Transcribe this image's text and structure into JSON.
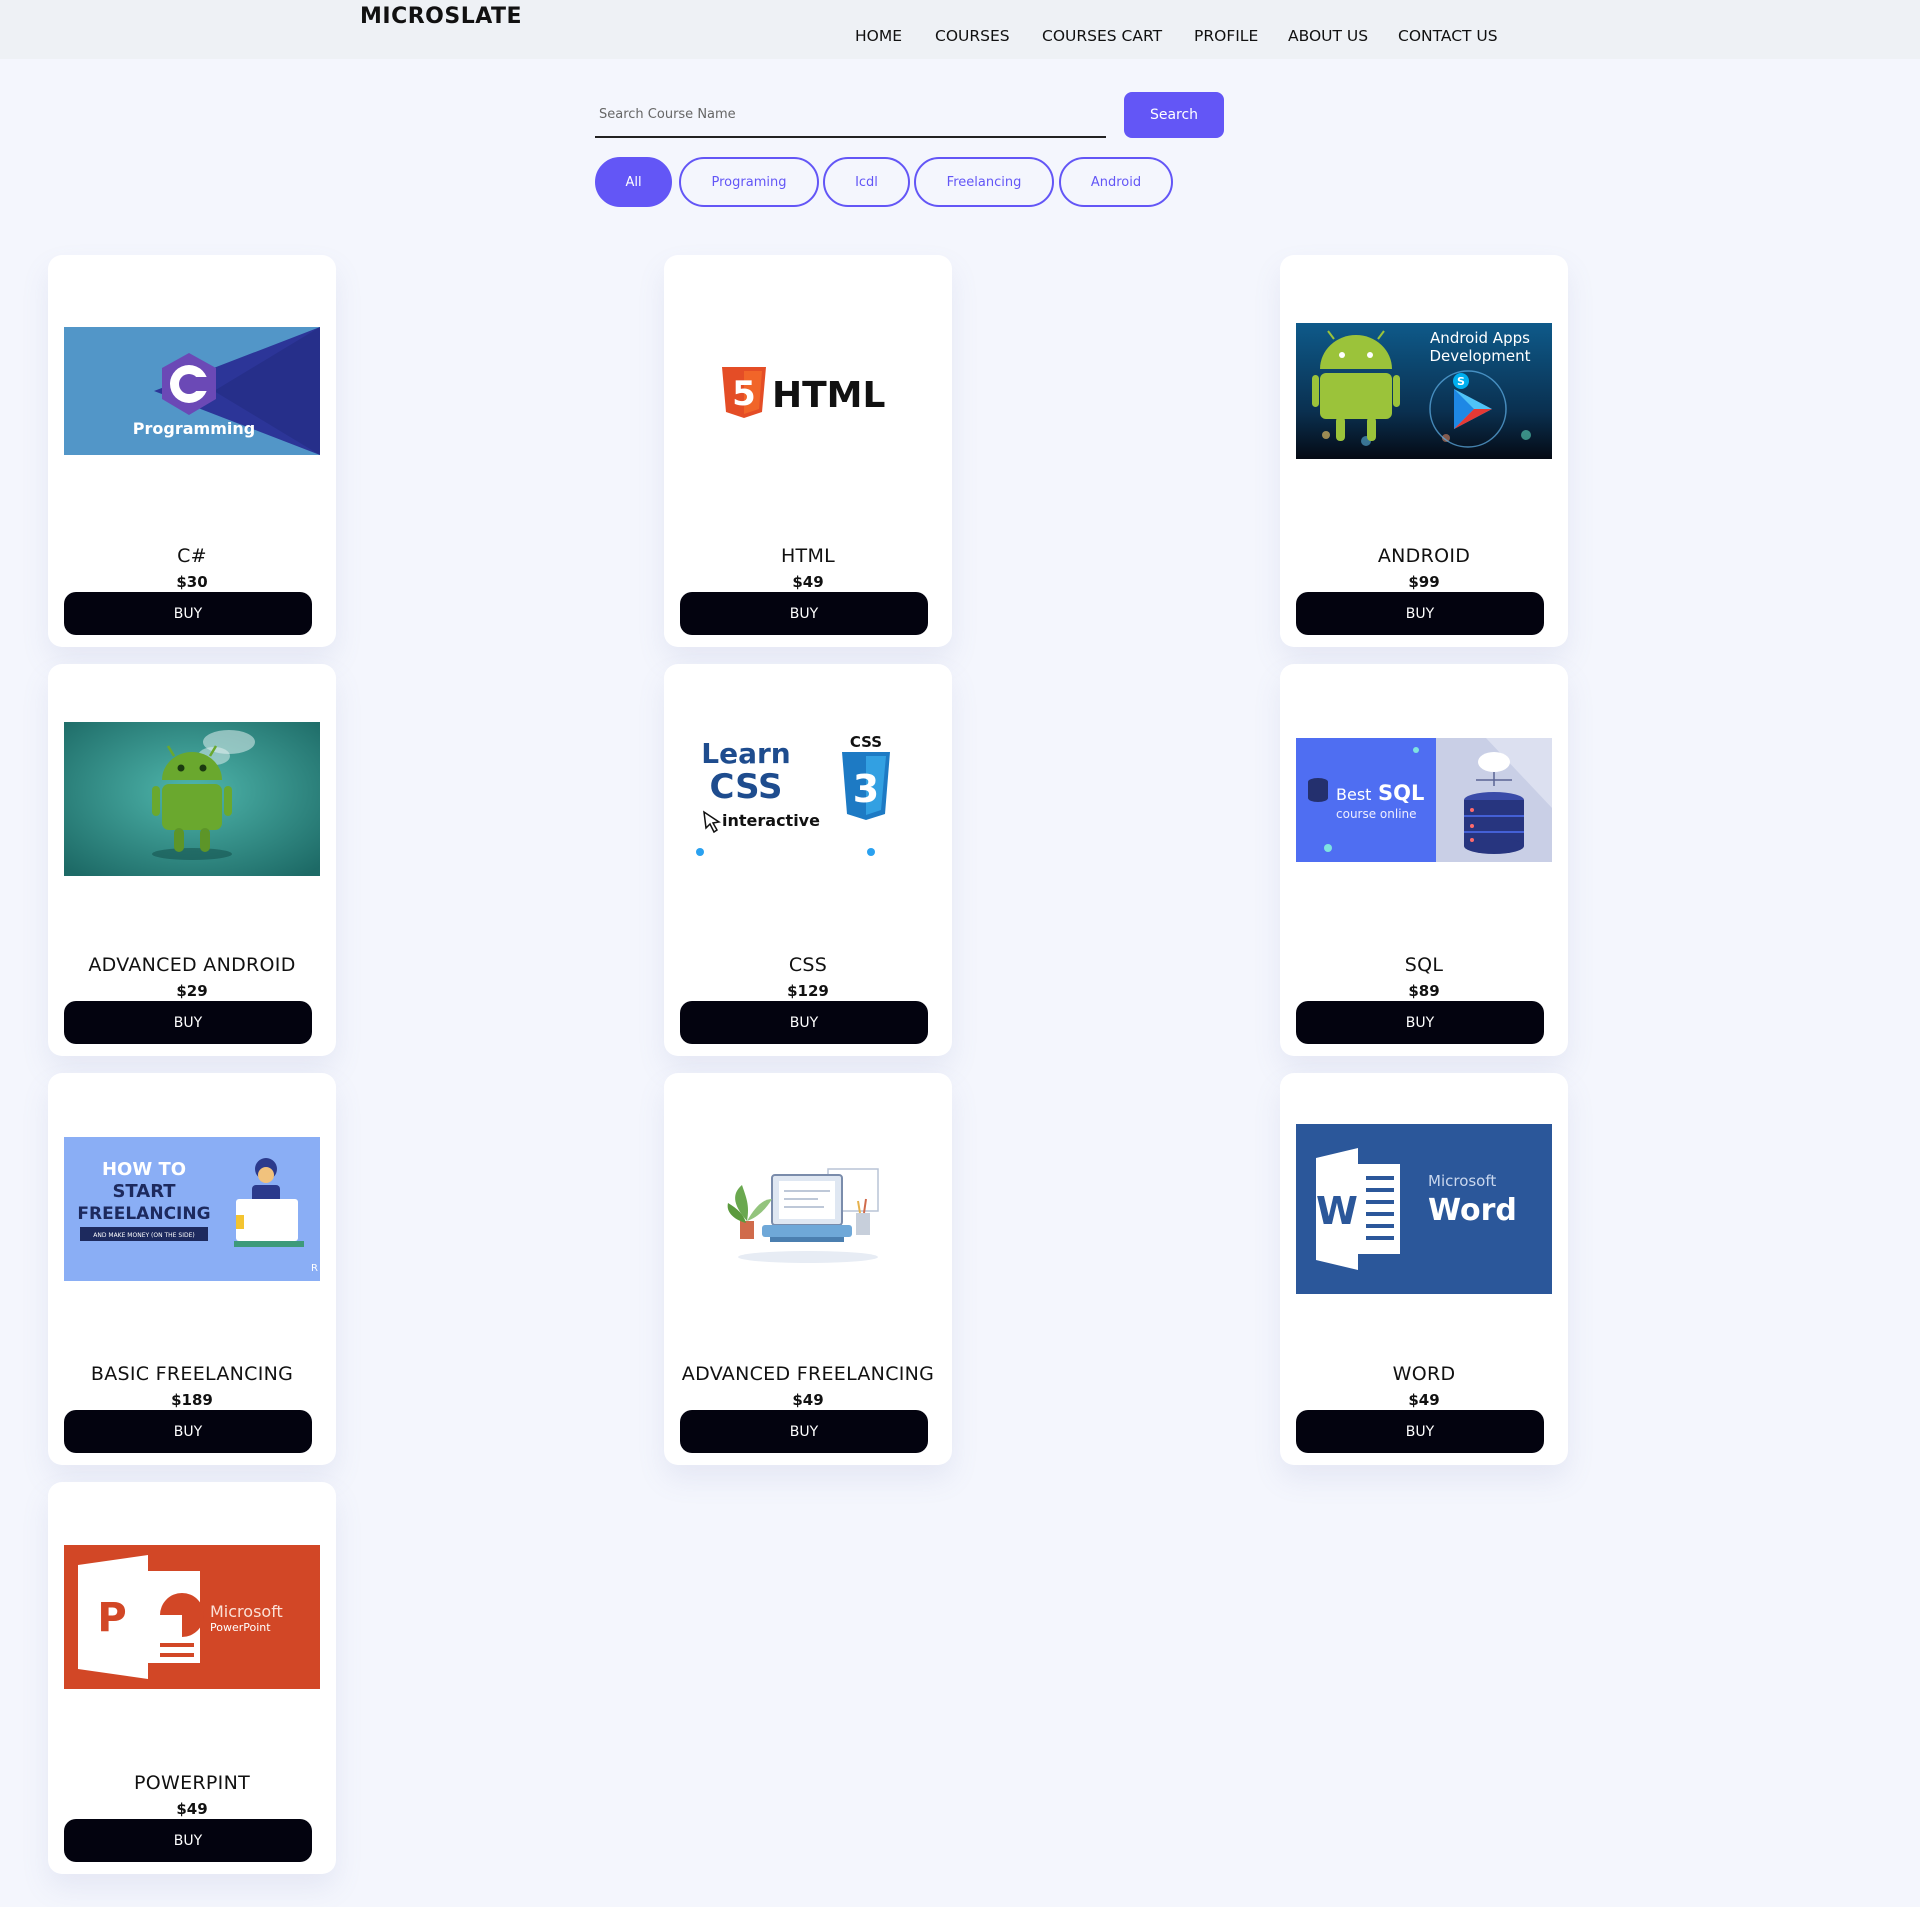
{
  "header": {
    "brand": "MICROSLATE",
    "nav": [
      "HOME",
      "COURSES",
      "COURSES CART",
      "PROFILE",
      "ABOUT US",
      "CONTACT US"
    ]
  },
  "search": {
    "placeholder": "Search Course Name",
    "value": "",
    "button_label": "Search"
  },
  "filters": [
    {
      "label": "All",
      "active": true
    },
    {
      "label": "Programing",
      "active": false
    },
    {
      "label": "Icdl",
      "active": false
    },
    {
      "label": "Freelancing",
      "active": false
    },
    {
      "label": "Android",
      "active": false
    }
  ],
  "courses": [
    {
      "title": "C#",
      "price": "$30",
      "buy_label": "BUY",
      "image": {
        "name": "csharp-programming-image",
        "text": [
          "C",
          "Programming"
        ]
      }
    },
    {
      "title": "HTML",
      "price": "$49",
      "buy_label": "BUY",
      "image": {
        "name": "html5-logo-image",
        "text": [
          "5",
          "HTML"
        ]
      }
    },
    {
      "title": "ANDROID",
      "price": "$99",
      "buy_label": "BUY",
      "image": {
        "name": "android-apps-development-image",
        "text": [
          "Android Apps",
          "Development"
        ]
      }
    },
    {
      "title": "ADVANCED ANDROID",
      "price": "$29",
      "buy_label": "BUY",
      "image": {
        "name": "android-robot-image",
        "text": []
      }
    },
    {
      "title": "CSS",
      "price": "$129",
      "buy_label": "BUY",
      "image": {
        "name": "learn-css-image",
        "text": [
          "Learn",
          "CSS",
          "interactive",
          "CSS",
          "3"
        ]
      }
    },
    {
      "title": "SQL",
      "price": "$89",
      "buy_label": "BUY",
      "image": {
        "name": "best-sql-course-image",
        "text": [
          "Best",
          "SQL",
          "course online"
        ]
      }
    },
    {
      "title": "BASIC FREELANCING",
      "price": "$189",
      "buy_label": "BUY",
      "image": {
        "name": "how-to-start-freelancing-image",
        "text": [
          "HOW TO",
          "START",
          "FREELANCING",
          "AND MAKE MONEY (ON THE SIDE)"
        ]
      }
    },
    {
      "title": "ADVANCED FREELANCING",
      "price": "$49",
      "buy_label": "BUY",
      "image": {
        "name": "laptop-illustration-image",
        "text": []
      }
    },
    {
      "title": "WORD",
      "price": "$49",
      "buy_label": "BUY",
      "image": {
        "name": "microsoft-word-image",
        "text": [
          "W",
          "Microsoft",
          "Word"
        ]
      }
    },
    {
      "title": "POWERPINT",
      "price": "$49",
      "buy_label": "BUY",
      "image": {
        "name": "microsoft-powerpoint-image",
        "text": [
          "P",
          "Microsoft",
          "PowerPoint"
        ]
      }
    }
  ],
  "colors": {
    "accent": "#6356f6",
    "page_background": "#f4f6fd",
    "header_background": "#eef1f5",
    "buy_button": "#03030f"
  }
}
